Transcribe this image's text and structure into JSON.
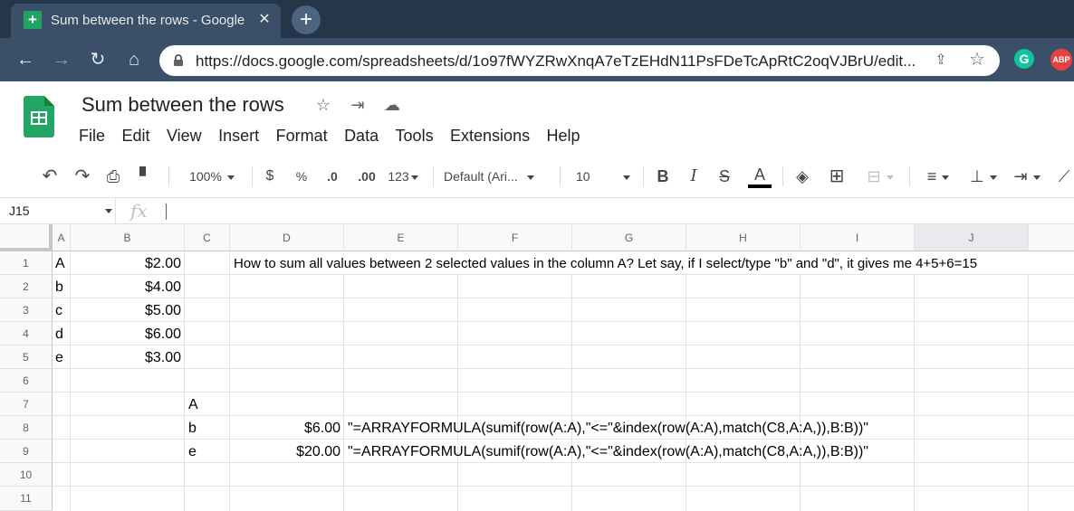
{
  "browser": {
    "tab_title": "Sum between the rows - Google",
    "url": "https://docs.google.com/spreadsheets/d/1o97fWYZRwXnqA7eTzEHdN11PsFDeTcApRtC2oqVJBrU/edit...",
    "extensions": [
      "G",
      "ABP"
    ]
  },
  "doc": {
    "title": "Sum between the rows",
    "menu": [
      "File",
      "Edit",
      "View",
      "Insert",
      "Format",
      "Data",
      "Tools",
      "Extensions",
      "Help"
    ]
  },
  "toolbar": {
    "zoom": "100%",
    "currency": "$",
    "percent": "%",
    "decrease_decimal": ".0",
    "increase_decimal": ".00",
    "more_formats": "123",
    "font": "Default (Ari...",
    "font_size": "10",
    "bold": "B",
    "italic": "I",
    "strike": "S",
    "text_color": "A"
  },
  "formula_bar": {
    "cell_ref": "J15",
    "fx": "fx",
    "formula": ""
  },
  "sheet": {
    "columns": [
      "A",
      "B",
      "C",
      "D",
      "E",
      "F",
      "G",
      "H",
      "I",
      "J"
    ],
    "selected_column": "J",
    "rows": [
      "1",
      "2",
      "3",
      "4",
      "5",
      "6",
      "7",
      "8",
      "9",
      "10",
      "11"
    ],
    "cells": {
      "A1": "A",
      "B1": "$2.00",
      "A2": "b",
      "B2": "$4.00",
      "A3": "c",
      "B3": "$5.00",
      "A4": "d",
      "B4": "$6.00",
      "A5": "e",
      "B5": "$3.00",
      "D1": "How to sum all values between 2 selected values in the column A? Let say, if I select/type \"b\" and \"d\", it gives me 4+5+6=15",
      "C7": "A",
      "C8": "b",
      "D8": "$6.00",
      "E8": "\"=ARRAYFORMULA(sumif(row(A:A),\"<=\"&index(row(A:A),match(C8,A:A,)),B:B))\"",
      "C9": "e",
      "D9": "$20.00",
      "E9": "\"=ARRAYFORMULA(sumif(row(A:A),\"<=\"&index(row(A:A),match(C8,A:A,)),B:B))\""
    }
  }
}
